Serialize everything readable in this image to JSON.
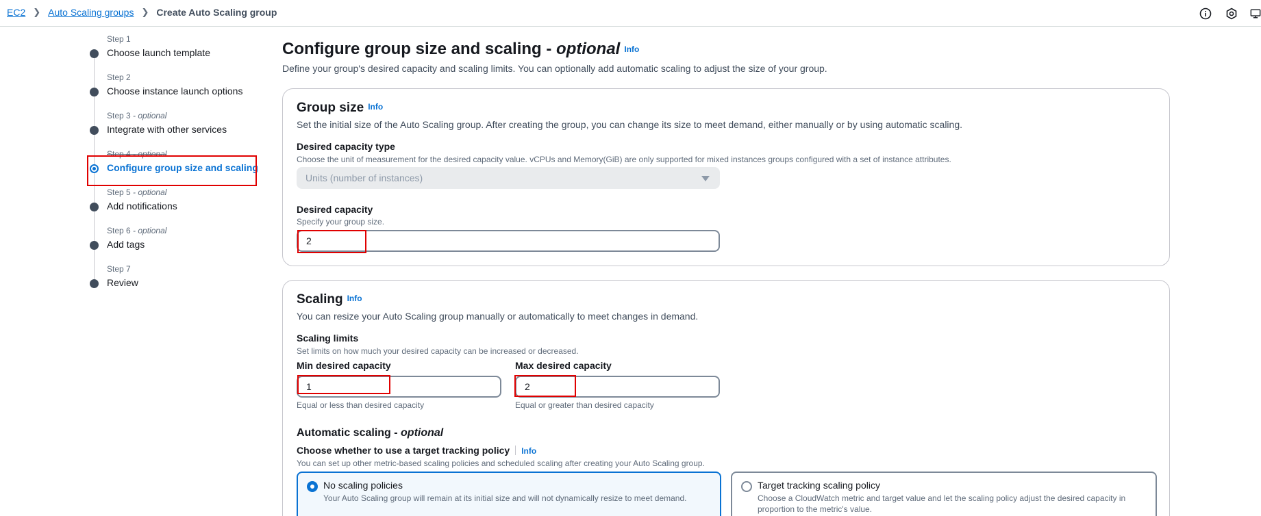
{
  "breadcrumb": {
    "items": [
      "EC2",
      "Auto Scaling groups"
    ],
    "current": "Create Auto Scaling group"
  },
  "top_icons": [
    "info-circle-icon",
    "settings-hex-icon",
    "monitor-icon"
  ],
  "steps": [
    {
      "num": "Step 1",
      "label": "Choose launch template"
    },
    {
      "num": "Step 2",
      "label": "Choose instance launch options"
    },
    {
      "num": "Step 3",
      "optional": " - optional",
      "label": "Integrate with other services"
    },
    {
      "num": "Step 4",
      "optional": " - optional",
      "label": "Configure group size and scaling"
    },
    {
      "num": "Step 5",
      "optional": " - optional",
      "label": "Add notifications"
    },
    {
      "num": "Step 6",
      "optional": " - optional",
      "label": "Add tags"
    },
    {
      "num": "Step 7",
      "label": "Review"
    }
  ],
  "page": {
    "title": "Configure group size and scaling - ",
    "title_optional": "optional",
    "info": "Info",
    "description": "Define your group's desired capacity and scaling limits. You can optionally add automatic scaling to adjust the size of your group."
  },
  "group_size": {
    "title": "Group size",
    "info": "Info",
    "description": "Set the initial size of the Auto Scaling group. After creating the group, you can change its size to meet demand, either manually or by using automatic scaling.",
    "capacity_type_label": "Desired capacity type",
    "capacity_type_desc": "Choose the unit of measurement for the desired capacity value. vCPUs and Memory(GiB) are only supported for mixed instances groups configured with a set of instance attributes.",
    "capacity_type_value": "Units (number of instances)",
    "desired_label": "Desired capacity",
    "desired_desc": "Specify your group size.",
    "desired_value": "2"
  },
  "scaling": {
    "title": "Scaling",
    "info": "Info",
    "description": "You can resize your Auto Scaling group manually or automatically to meet changes in demand.",
    "limits_label": "Scaling limits",
    "limits_desc": "Set limits on how much your desired capacity can be increased or decreased.",
    "min_label": "Min desired capacity",
    "min_value": "1",
    "min_hint": "Equal or less than desired capacity",
    "max_label": "Max desired capacity",
    "max_value": "2",
    "max_hint": "Equal or greater than desired capacity",
    "auto_title": "Automatic scaling - ",
    "auto_optional": "optional",
    "policy_label": "Choose whether to use a target tracking policy",
    "policy_info": "Info",
    "policy_desc": "You can set up other metric-based scaling policies and scheduled scaling after creating your Auto Scaling group.",
    "option_none_label": "No scaling policies",
    "option_none_desc": "Your Auto Scaling group will remain at its initial size and will not dynamically resize to meet demand.",
    "option_target_label": "Target tracking scaling policy",
    "option_target_desc": "Choose a CloudWatch metric and target value and let the scaling policy adjust the desired capacity in proportion to the metric's value.",
    "selected_option": "No scaling policies"
  },
  "colors": {
    "link": "#0972d3",
    "highlight_box": "#e00000",
    "text": "#16191f"
  }
}
